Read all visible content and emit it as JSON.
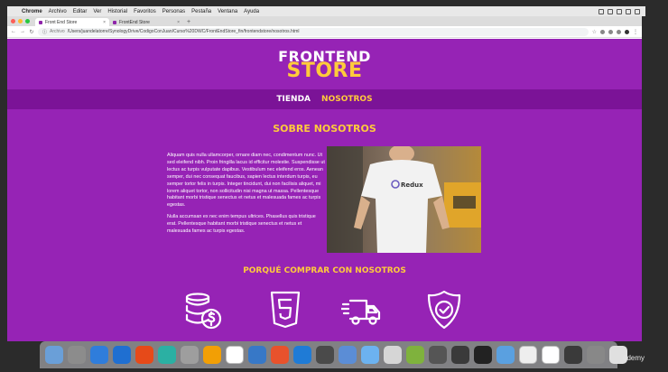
{
  "menubar": {
    "items": [
      "Chrome",
      "Archivo",
      "Editar",
      "Ver",
      "Historial",
      "Favoritos",
      "Personas",
      "Pestaña",
      "Ventana",
      "Ayuda"
    ]
  },
  "browser": {
    "tabs": [
      {
        "label": "Front End Store",
        "active": true
      },
      {
        "label": "FrontEnd Store",
        "active": false
      }
    ],
    "new_tab": "+",
    "address_scheme": "Archivo",
    "address": "/Users/juandelatorre/SynologyDrive/CodigoConJuan/Curso%20DWC/FrontEndStore_fin/frontendstore/nosotros.html"
  },
  "site": {
    "logo_top": "FRONTEND",
    "logo_bottom": "STORE",
    "nav": [
      {
        "label": "TIENDA",
        "active": false
      },
      {
        "label": "NOSOTROS",
        "active": true
      }
    ],
    "about_title": "SOBRE NOSOTROS",
    "paragraphs": [
      "Aliquam quis nulla ullamcorper, ornare diam nec, condimentum nunc. Ut sed eleifend nibh. Proin fringilla lacus id efficitur molestie. Suspendisse ut lectus ac turpis vulputate dapibus. Vestibulum nec eleifend eros. Aenean semper, dui nec consequat faucibus, sapien lectus interdum turpis, eu semper tortor felis in turpis. Integer tincidunt, dui non facilisis aliquet, mi lorem aliquet tortor, non sollicitudin nisi magna ut massa. Pellentesque habitant morbi tristique senectus et netus et malesuada fames ac turpis egestas.",
      "Nulla accumsan ex nec enim tempus ultrices. Phasellus quis tristique erat. Pellentesque habitant morbi tristique senectus et netus et malesuada fames ac turpis egestas."
    ],
    "photo_shirt_text": "Redux",
    "why_title": "PORQUÉ COMPRAR CON NOSOTROS",
    "features": [
      {
        "icon": "coins-dollar-icon"
      },
      {
        "icon": "html5-icon"
      },
      {
        "icon": "delivery-truck-icon"
      },
      {
        "icon": "shield-check-icon"
      }
    ]
  },
  "dock": {
    "colors": [
      "#6a9fd8",
      "#8c8c8c",
      "#2f7ddb",
      "#1f6fd1",
      "#e64a19",
      "#2bb0a3",
      "#9e9e9e",
      "#f29f05",
      "#ffffff",
      "#3778c7",
      "#e8522c",
      "#1f7bd6",
      "#4a4a4a",
      "#5b8dd6",
      "#6cb2f0",
      "#d6d6d6",
      "#7fb23d",
      "#555555",
      "#3a3a3a",
      "#222222",
      "#5aa0e0",
      "#eeeeee",
      "#ffffff",
      "#3a3a3a",
      "#888888",
      "#e0e0e0"
    ],
    "udemy": "ūdemy"
  },
  "colors": {
    "page_bg": "#9623b5",
    "nav_bg": "#7b1397",
    "accent": "#ffcb3b"
  }
}
